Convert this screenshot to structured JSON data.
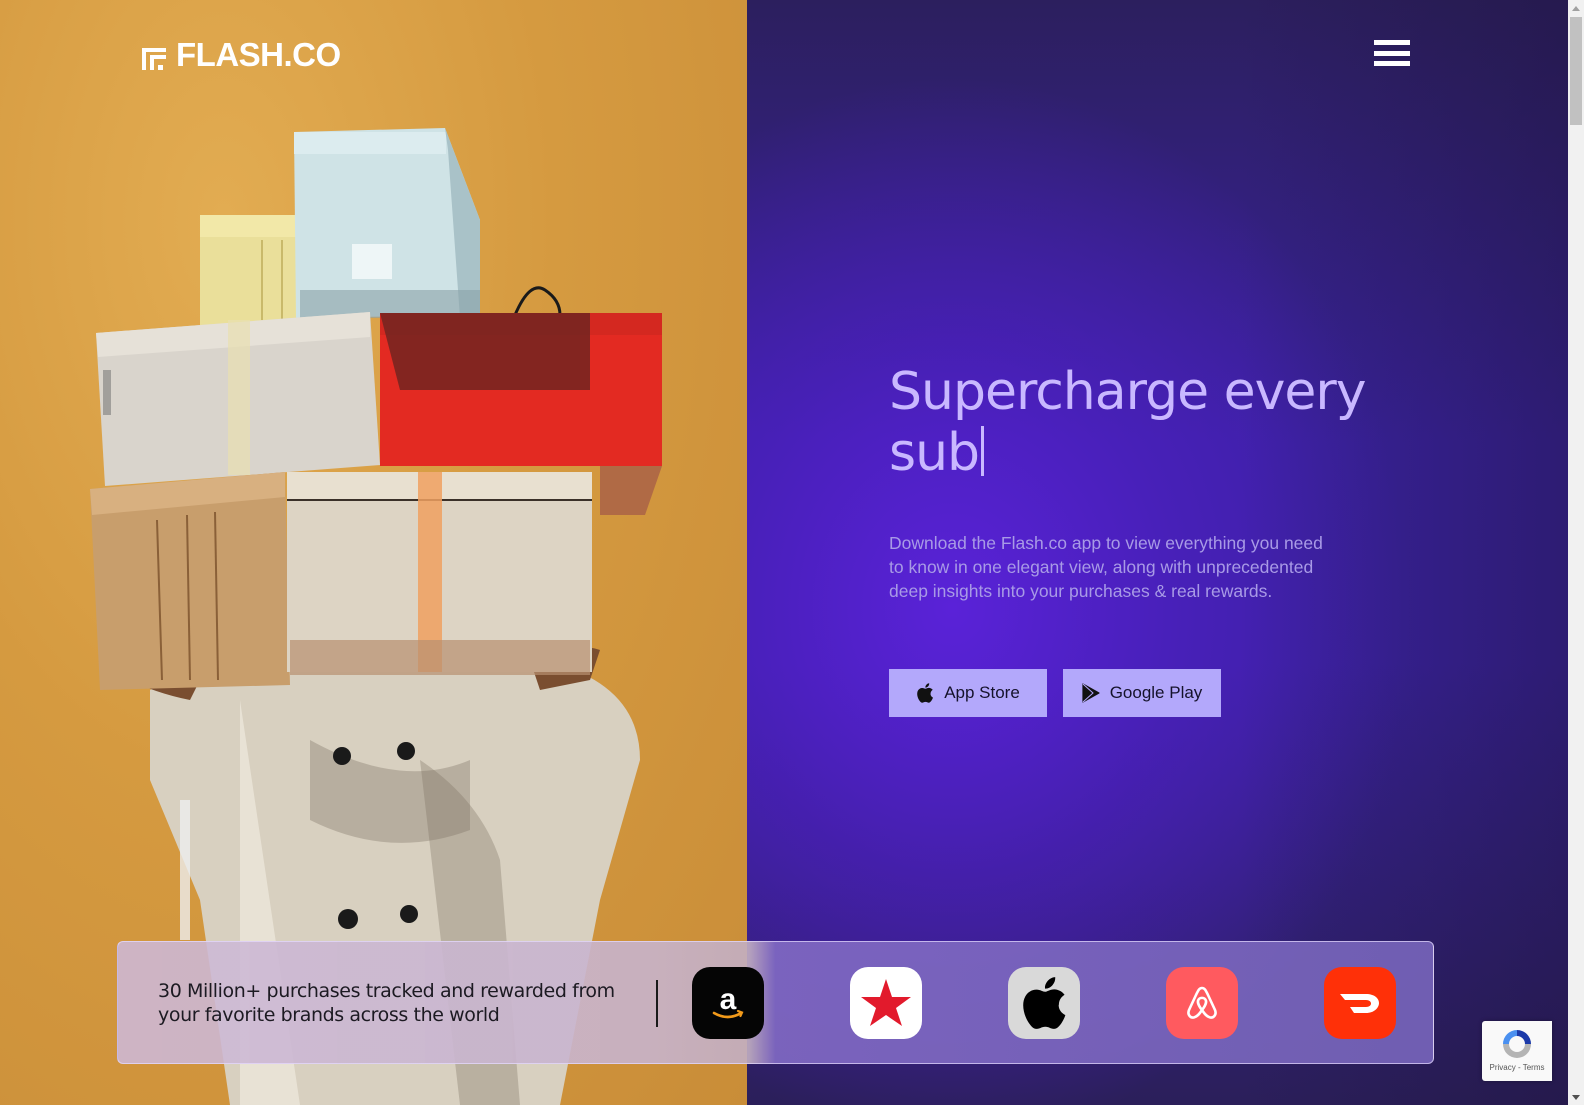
{
  "header": {
    "logo_text": "FLASH.CO",
    "menu_icon": "hamburger-menu-icon"
  },
  "hero": {
    "title_line1": "Supercharge every",
    "title_line2": "sub",
    "description": "Download the Flash.co app to view everything you need to know in one elegant view, along with unprecedented deep insights into your purchases & real rewards.",
    "buttons": [
      {
        "label": "App Store",
        "icon": "apple-icon"
      },
      {
        "label": "Google Play",
        "icon": "google-play-icon"
      }
    ]
  },
  "banner": {
    "text": "30 Million+ purchases tracked and rewarded from your favorite brands across the world",
    "brands": [
      {
        "name": "Amazon",
        "icon": "amazon-logo-icon",
        "bg": "#050505"
      },
      {
        "name": "Macy's",
        "icon": "macys-star-icon",
        "bg": "#ffffff"
      },
      {
        "name": "Apple",
        "icon": "apple-logo-icon",
        "bg": "#d9d9d9"
      },
      {
        "name": "Airbnb",
        "icon": "airbnb-logo-icon",
        "bg": "#ff5a5f"
      },
      {
        "name": "DoorDash",
        "icon": "doordash-logo-icon",
        "bg": "#ff3008"
      }
    ]
  },
  "recaptcha": {
    "links": "Privacy - Terms"
  },
  "colors": {
    "hero_title": "#c9b8ff",
    "button_bg": "#b3a8fb",
    "photo_bg": "#d59a40",
    "hero_bg": "#3a22a0"
  }
}
